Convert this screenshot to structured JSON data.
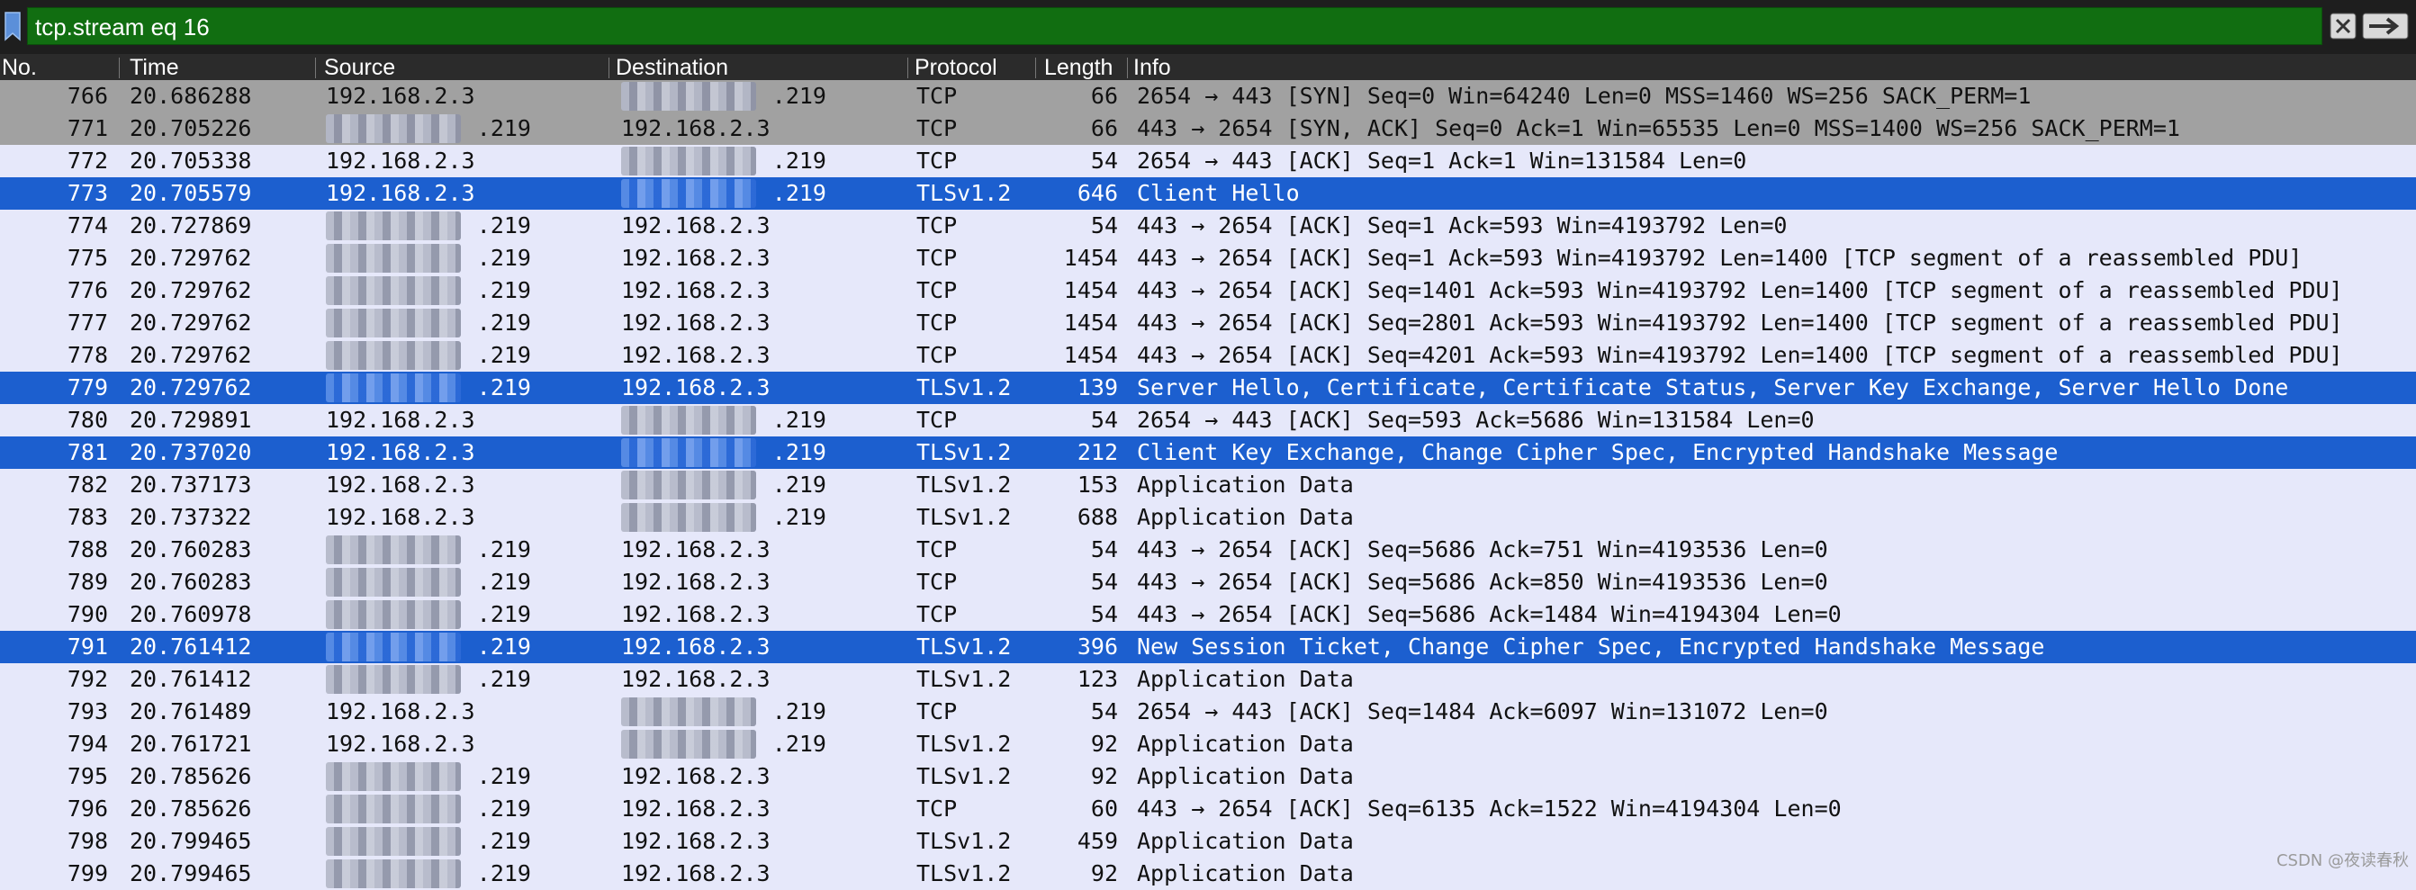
{
  "filter": {
    "value": "tcp.stream eq 16"
  },
  "columns": [
    "No.",
    "Time",
    "Source",
    "Destination",
    "Protocol",
    "Length",
    "Info"
  ],
  "colors": {
    "syn": "#a1a1a1",
    "selected": "#1c5fcf",
    "normal": "#e6e8fa",
    "filter": "#116e11"
  },
  "rows": [
    {
      "no": "766",
      "time": "20.686288",
      "src": "192.168.2.3",
      "dst": ".219",
      "proto": "TCP",
      "len": "66",
      "info": "2654 → 443 [SYN] Seq=0 Win=64240 Len=0 MSS=1460 WS=256 SACK_PERM=1",
      "style": "syn"
    },
    {
      "no": "771",
      "time": "20.705226",
      "src": ".219",
      "dst": "192.168.2.3",
      "proto": "TCP",
      "len": "66",
      "info": "443 → 2654 [SYN, ACK] Seq=0 Ack=1 Win=65535 Len=0 MSS=1400 WS=256 SACK_PERM=1",
      "style": "syn"
    },
    {
      "no": "772",
      "time": "20.705338",
      "src": "192.168.2.3",
      "dst": ".219",
      "proto": "TCP",
      "len": "54",
      "info": "2654 → 443 [ACK] Seq=1 Ack=1 Win=131584 Len=0",
      "style": "normal"
    },
    {
      "no": "773",
      "time": "20.705579",
      "src": "192.168.2.3",
      "dst": ".219",
      "proto": "TLSv1.2",
      "len": "646",
      "info": "Client Hello",
      "style": "sel"
    },
    {
      "no": "774",
      "time": "20.727869",
      "src": ".219",
      "dst": "192.168.2.3",
      "proto": "TCP",
      "len": "54",
      "info": "443 → 2654 [ACK] Seq=1 Ack=593 Win=4193792 Len=0",
      "style": "normal"
    },
    {
      "no": "775",
      "time": "20.729762",
      "src": ".219",
      "dst": "192.168.2.3",
      "proto": "TCP",
      "len": "1454",
      "info": "443 → 2654 [ACK] Seq=1 Ack=593 Win=4193792 Len=1400 [TCP segment of a reassembled PDU]",
      "style": "normal"
    },
    {
      "no": "776",
      "time": "20.729762",
      "src": ".219",
      "dst": "192.168.2.3",
      "proto": "TCP",
      "len": "1454",
      "info": "443 → 2654 [ACK] Seq=1401 Ack=593 Win=4193792 Len=1400 [TCP segment of a reassembled PDU]",
      "style": "normal"
    },
    {
      "no": "777",
      "time": "20.729762",
      "src": ".219",
      "dst": "192.168.2.3",
      "proto": "TCP",
      "len": "1454",
      "info": "443 → 2654 [ACK] Seq=2801 Ack=593 Win=4193792 Len=1400 [TCP segment of a reassembled PDU]",
      "style": "normal"
    },
    {
      "no": "778",
      "time": "20.729762",
      "src": ".219",
      "dst": "192.168.2.3",
      "proto": "TCP",
      "len": "1454",
      "info": "443 → 2654 [ACK] Seq=4201 Ack=593 Win=4193792 Len=1400 [TCP segment of a reassembled PDU]",
      "style": "normal"
    },
    {
      "no": "779",
      "time": "20.729762",
      "src": ".219",
      "dst": "192.168.2.3",
      "proto": "TLSv1.2",
      "len": "139",
      "info": "Server Hello, Certificate, Certificate Status, Server Key Exchange, Server Hello Done",
      "style": "sel"
    },
    {
      "no": "780",
      "time": "20.729891",
      "src": "192.168.2.3",
      "dst": ".219",
      "proto": "TCP",
      "len": "54",
      "info": "2654 → 443 [ACK] Seq=593 Ack=5686 Win=131584 Len=0",
      "style": "normal"
    },
    {
      "no": "781",
      "time": "20.737020",
      "src": "192.168.2.3",
      "dst": ".219",
      "proto": "TLSv1.2",
      "len": "212",
      "info": "Client Key Exchange, Change Cipher Spec, Encrypted Handshake Message",
      "style": "sel"
    },
    {
      "no": "782",
      "time": "20.737173",
      "src": "192.168.2.3",
      "dst": ".219",
      "proto": "TLSv1.2",
      "len": "153",
      "info": "Application Data",
      "style": "normal"
    },
    {
      "no": "783",
      "time": "20.737322",
      "src": "192.168.2.3",
      "dst": ".219",
      "proto": "TLSv1.2",
      "len": "688",
      "info": "Application Data",
      "style": "normal"
    },
    {
      "no": "788",
      "time": "20.760283",
      "src": ".219",
      "dst": "192.168.2.3",
      "proto": "TCP",
      "len": "54",
      "info": "443 → 2654 [ACK] Seq=5686 Ack=751 Win=4193536 Len=0",
      "style": "normal"
    },
    {
      "no": "789",
      "time": "20.760283",
      "src": ".219",
      "dst": "192.168.2.3",
      "proto": "TCP",
      "len": "54",
      "info": "443 → 2654 [ACK] Seq=5686 Ack=850 Win=4193536 Len=0",
      "style": "normal"
    },
    {
      "no": "790",
      "time": "20.760978",
      "src": ".219",
      "dst": "192.168.2.3",
      "proto": "TCP",
      "len": "54",
      "info": "443 → 2654 [ACK] Seq=5686 Ack=1484 Win=4194304 Len=0",
      "style": "normal"
    },
    {
      "no": "791",
      "time": "20.761412",
      "src": ".219",
      "dst": "192.168.2.3",
      "proto": "TLSv1.2",
      "len": "396",
      "info": "New Session Ticket, Change Cipher Spec, Encrypted Handshake Message",
      "style": "sel"
    },
    {
      "no": "792",
      "time": "20.761412",
      "src": ".219",
      "dst": "192.168.2.3",
      "proto": "TLSv1.2",
      "len": "123",
      "info": "Application Data",
      "style": "normal"
    },
    {
      "no": "793",
      "time": "20.761489",
      "src": "192.168.2.3",
      "dst": ".219",
      "proto": "TCP",
      "len": "54",
      "info": "2654 → 443 [ACK] Seq=1484 Ack=6097 Win=131072 Len=0",
      "style": "normal"
    },
    {
      "no": "794",
      "time": "20.761721",
      "src": "192.168.2.3",
      "dst": ".219",
      "proto": "TLSv1.2",
      "len": "92",
      "info": "Application Data",
      "style": "normal"
    },
    {
      "no": "795",
      "time": "20.785626",
      "src": ".219",
      "dst": "192.168.2.3",
      "proto": "TLSv1.2",
      "len": "92",
      "info": "Application Data",
      "style": "normal"
    },
    {
      "no": "796",
      "time": "20.785626",
      "src": ".219",
      "dst": "192.168.2.3",
      "proto": "TCP",
      "len": "60",
      "info": "443 → 2654 [ACK] Seq=6135 Ack=1522 Win=4194304 Len=0",
      "style": "normal"
    },
    {
      "no": "798",
      "time": "20.799465",
      "src": ".219",
      "dst": "192.168.2.3",
      "proto": "TLSv1.2",
      "len": "459",
      "info": "Application Data",
      "style": "normal"
    },
    {
      "no": "799",
      "time": "20.799465",
      "src": ".219",
      "dst": "192.168.2.3",
      "proto": "TLSv1.2",
      "len": "92",
      "info": "Application Data",
      "style": "normal"
    }
  ],
  "watermark": "CSDN @夜读春秋"
}
